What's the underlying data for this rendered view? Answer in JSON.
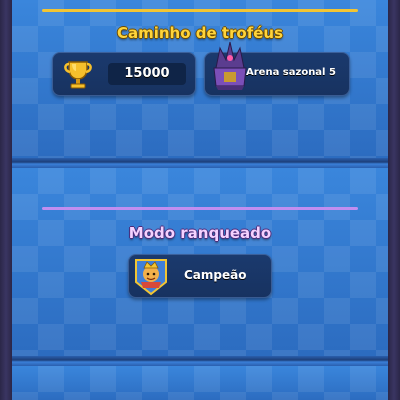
{
  "trophy_road": {
    "title": "Caminho de troféus",
    "trophies": "15000",
    "arena": "Arena sazonal 5"
  },
  "ranked": {
    "title": "Modo ranqueado",
    "league": "Campeão"
  },
  "colors": {
    "panel_blue": "#2f73c9",
    "gold_rule": "#f2c533",
    "purple_rule": "#c08ef0",
    "title_gold": "#ffd43a"
  },
  "icons": [
    "trophy-icon",
    "arena-icon",
    "champion-league-badge-icon"
  ]
}
